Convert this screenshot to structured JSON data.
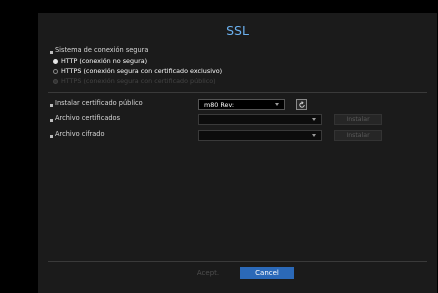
{
  "dialog": {
    "title": "SSL"
  },
  "secure": {
    "heading": "Sistema de conexión segura",
    "options": [
      {
        "label": "HTTP (conexión no segura)",
        "state": "selected"
      },
      {
        "label": "HTTPS (conexión segura con certificado exclusivo)",
        "state": "unselected"
      },
      {
        "label": "HTTPS (conexión segura con certificado público)",
        "state": "disabled"
      }
    ]
  },
  "cert": {
    "public_label": "Instalar certificado público",
    "public_value": "m80 Rev:",
    "cert_files_label": "Archivo certificados",
    "cert_files_value": "",
    "cipher_label": "Archivo cifrado",
    "cipher_value": "",
    "install_label": "Instalar"
  },
  "footer": {
    "accept_label": "Acept.",
    "cancel_label": "Cancel"
  },
  "icons": {
    "refresh": "refresh-icon",
    "dropdown": "chevron-down-icon"
  },
  "colors": {
    "title": "#6bb0ee",
    "cancel_button": "#2b69b8"
  }
}
